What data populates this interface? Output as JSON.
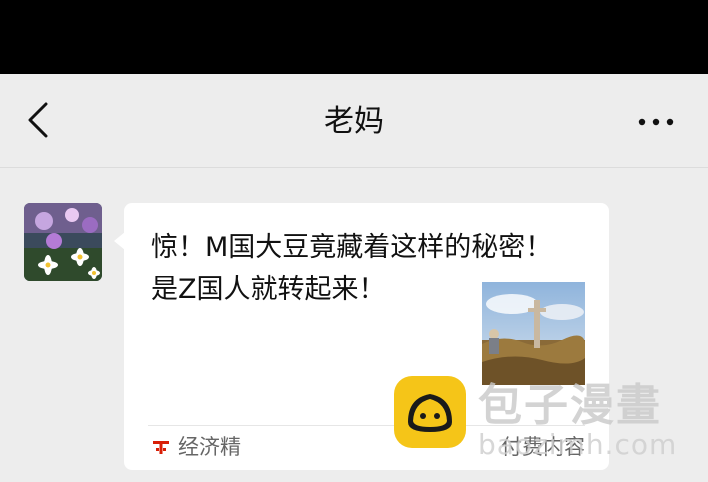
{
  "header": {
    "title": "老妈",
    "back_icon": "chevron-left-icon",
    "more_icon": "more-dots-icon"
  },
  "message": {
    "sender_avatar": "flower-avatar",
    "card": {
      "title": "惊！M国大豆竟藏着这样的秘密！是Z国人就转起来！",
      "thumbnail": "soybean-field-photo",
      "source": "经济精",
      "source_icon": "red-t-icon",
      "paid_label": "付费内容"
    }
  },
  "watermark": {
    "text": "包子漫畫",
    "url": "baozimh.com"
  },
  "colors": {
    "background": "#ededed",
    "status_bar": "#000000",
    "bubble": "#ffffff",
    "source_icon": "#d81e06",
    "watermark_logo": "#f5c518"
  }
}
